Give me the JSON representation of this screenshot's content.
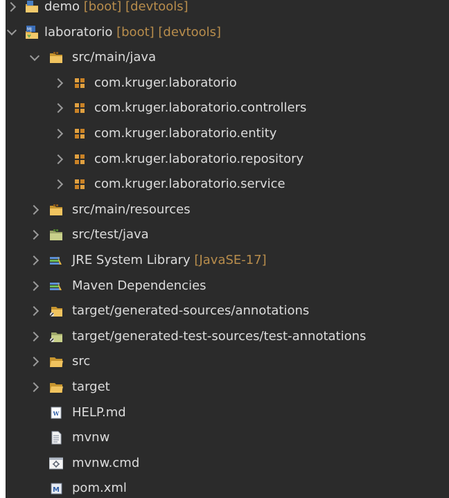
{
  "tree": {
    "items": [
      {
        "label": "demo",
        "decoration": " [boot] [devtools]",
        "icon": "spring-project-icon",
        "state": "collapsed",
        "level": 0
      },
      {
        "label": "laboratorio",
        "decoration": " [boot] [devtools]",
        "icon": "maven-spring-project-icon",
        "state": "expanded",
        "level": 0
      },
      {
        "label": "src/main/java",
        "decoration": "",
        "icon": "source-folder-icon",
        "state": "expanded",
        "level": 1
      },
      {
        "label": "com.kruger.laboratorio",
        "decoration": "",
        "icon": "package-icon",
        "state": "collapsed",
        "level": 2
      },
      {
        "label": "com.kruger.laboratorio.controllers",
        "decoration": "",
        "icon": "package-icon",
        "state": "collapsed",
        "level": 2
      },
      {
        "label": "com.kruger.laboratorio.entity",
        "decoration": "",
        "icon": "package-icon",
        "state": "collapsed",
        "level": 2
      },
      {
        "label": "com.kruger.laboratorio.repository",
        "decoration": "",
        "icon": "package-icon",
        "state": "collapsed",
        "level": 2
      },
      {
        "label": "com.kruger.laboratorio.service",
        "decoration": "",
        "icon": "package-icon",
        "state": "collapsed",
        "level": 2
      },
      {
        "label": "src/main/resources",
        "decoration": "",
        "icon": "source-folder-icon",
        "state": "collapsed",
        "level": 1
      },
      {
        "label": "src/test/java",
        "decoration": "",
        "icon": "test-source-folder-icon",
        "state": "collapsed",
        "level": 1
      },
      {
        "label": "JRE System Library",
        "decoration": " [JavaSE-17]",
        "icon": "library-icon",
        "state": "collapsed",
        "level": 1
      },
      {
        "label": "Maven Dependencies",
        "decoration": "",
        "icon": "library-icon",
        "state": "collapsed",
        "level": 1
      },
      {
        "label": "target/generated-sources/annotations",
        "decoration": "",
        "icon": "generated-source-folder-icon",
        "state": "collapsed",
        "level": 1
      },
      {
        "label": "target/generated-test-sources/test-annotations",
        "decoration": "",
        "icon": "generated-test-source-folder-icon",
        "state": "collapsed",
        "level": 1
      },
      {
        "label": "src",
        "decoration": "",
        "icon": "folder-icon",
        "state": "collapsed",
        "level": 1
      },
      {
        "label": "target",
        "decoration": "",
        "icon": "folder-icon",
        "state": "collapsed",
        "level": 1
      },
      {
        "label": "HELP.md",
        "decoration": "",
        "icon": "markdown-file-icon",
        "state": "leaf",
        "level": 1
      },
      {
        "label": "mvnw",
        "decoration": "",
        "icon": "text-file-icon",
        "state": "leaf",
        "level": 1
      },
      {
        "label": "mvnw.cmd",
        "decoration": "",
        "icon": "cmd-file-icon",
        "state": "leaf",
        "level": 1
      },
      {
        "label": "pom.xml",
        "decoration": "",
        "icon": "maven-pom-icon",
        "state": "leaf",
        "level": 1
      }
    ]
  },
  "colors": {
    "background": "#2b2b2b",
    "text": "#dcdcdc",
    "decoration": "#b88d4c",
    "arrow": "#9a9a9a"
  }
}
